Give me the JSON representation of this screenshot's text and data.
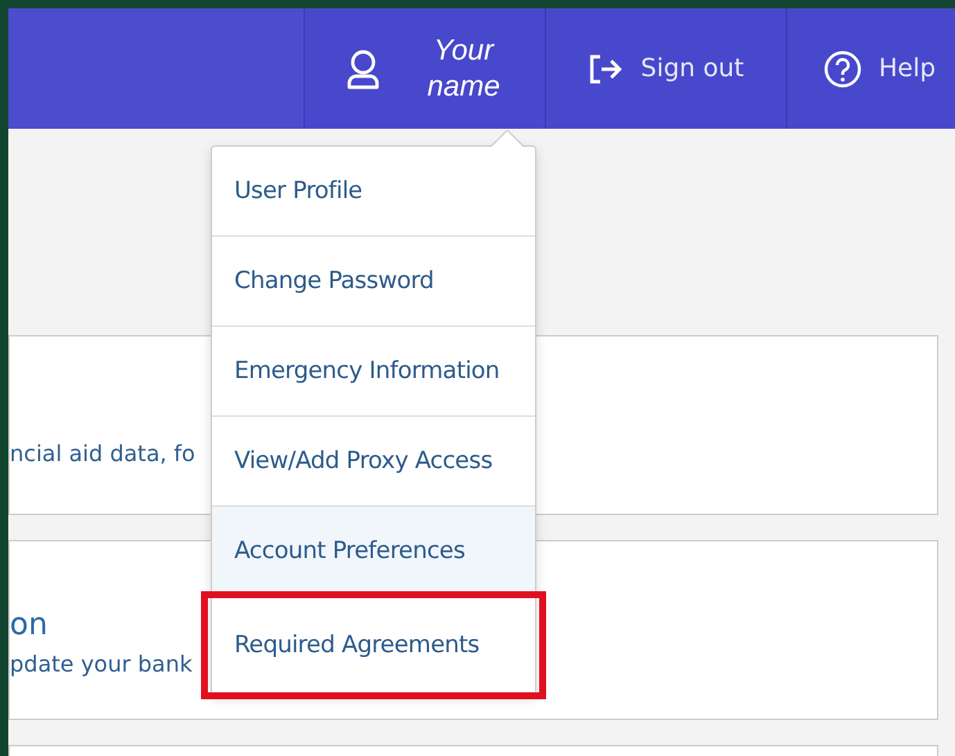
{
  "header": {
    "user": {
      "name": "Your name"
    },
    "sign_out": "Sign out",
    "help": "Help"
  },
  "cards": [
    {
      "kind": "text",
      "text": "ncial aid data, fo"
    },
    {
      "kind": "heading",
      "heading": "on",
      "text": "pdate your bank"
    },
    {
      "kind": "blank"
    }
  ],
  "user_menu": {
    "items": [
      {
        "label": "User Profile",
        "hovered": false,
        "highlighted": false
      },
      {
        "label": "Change Password",
        "hovered": false,
        "highlighted": false
      },
      {
        "label": "Emergency Information",
        "hovered": false,
        "highlighted": false
      },
      {
        "label": "View/Add Proxy Access",
        "hovered": false,
        "highlighted": false
      },
      {
        "label": "Account Preferences",
        "hovered": true,
        "highlighted": false
      },
      {
        "label": "Required Agreements",
        "hovered": false,
        "highlighted": true
      }
    ]
  }
}
